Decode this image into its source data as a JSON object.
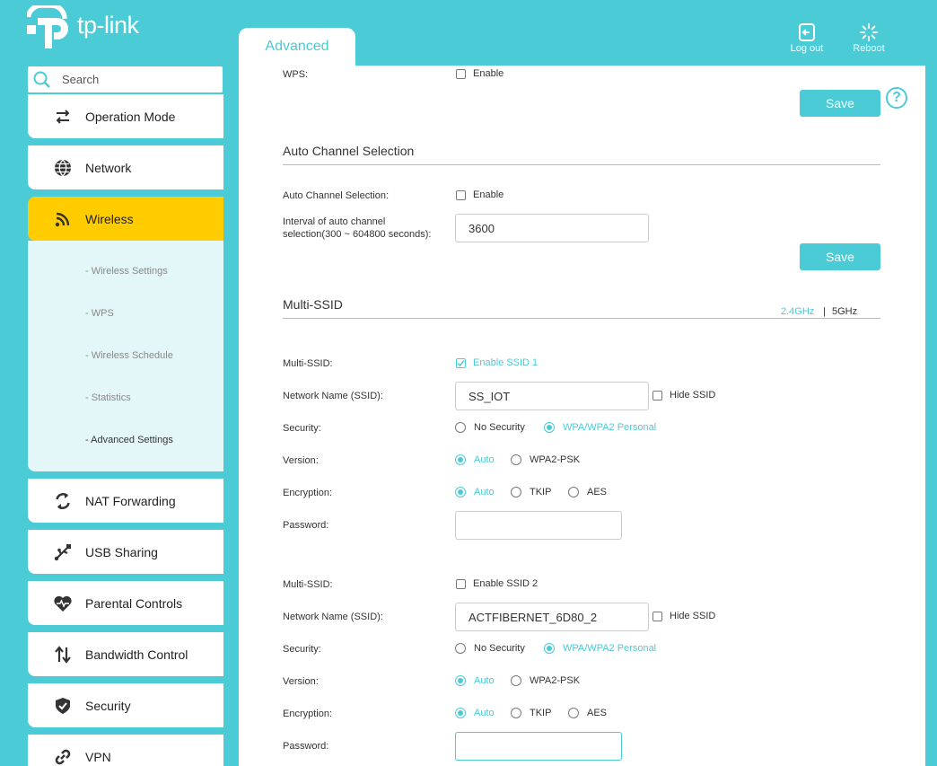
{
  "header": {
    "logo_text": "tp-link",
    "tab_label": "Advanced",
    "logout_label": "Log out",
    "reboot_label": "Reboot"
  },
  "sidebar": {
    "search_placeholder": "Search",
    "items": [
      {
        "label": "Operation Mode",
        "icon": "operation-mode-icon"
      },
      {
        "label": "Network",
        "icon": "globe-icon"
      },
      {
        "label": "Wireless",
        "icon": "wifi-icon",
        "active": true
      },
      {
        "label": "NAT Forwarding",
        "icon": "nat-icon"
      },
      {
        "label": "USB Sharing",
        "icon": "usb-icon"
      },
      {
        "label": "Parental Controls",
        "icon": "heart-icon"
      },
      {
        "label": "Bandwidth Control",
        "icon": "bandwidth-icon"
      },
      {
        "label": "Security",
        "icon": "shield-icon"
      },
      {
        "label": "VPN",
        "icon": "link-icon"
      }
    ],
    "submenu": [
      "- Wireless Settings",
      "- WPS",
      "- Wireless Schedule",
      "- Statistics",
      "- Advanced Settings"
    ]
  },
  "main": {
    "wps_label": "WPS:",
    "wps_enable": "Enable",
    "save_label": "Save",
    "help_label": "?",
    "auto_channel": {
      "title": "Auto Channel Selection",
      "label": "Auto Channel Selection:",
      "enable": "Enable",
      "interval_label_1": "Interval of auto channel",
      "interval_label_2": "selection(300 ~ 604800 seconds):",
      "interval_value": "3600"
    },
    "multi_ssid": {
      "title": "Multi-SSID",
      "band_24": "2.4GHz",
      "band_sep": "|",
      "band_5": "5GHz",
      "ssid1": {
        "multi_label": "Multi-SSID:",
        "enable_label": "Enable SSID 1",
        "enabled": true,
        "name_label": "Network Name (SSID):",
        "name_value": "SS_IOT",
        "hide": "Hide SSID",
        "security_label": "Security:",
        "sec_none": "No Security",
        "sec_wpa": "WPA/WPA2 Personal",
        "version_label": "Version:",
        "ver_auto": "Auto",
        "ver_wpa2": "WPA2-PSK",
        "enc_label": "Encryption:",
        "enc_auto": "Auto",
        "enc_tkip": "TKIP",
        "enc_aes": "AES",
        "password_label": "Password:",
        "password_value": ""
      },
      "ssid2": {
        "multi_label": "Multi-SSID:",
        "enable_label": "Enable SSID 2",
        "enabled": false,
        "name_label": "Network Name (SSID):",
        "name_value": "ACTFIBERNET_6D80_2",
        "hide": "Hide SSID",
        "security_label": "Security:",
        "sec_none": "No Security",
        "sec_wpa": "WPA/WPA2 Personal",
        "version_label": "Version:",
        "ver_auto": "Auto",
        "ver_wpa2": "WPA2-PSK",
        "enc_label": "Encryption:",
        "enc_auto": "Auto",
        "enc_tkip": "TKIP",
        "enc_aes": "AES",
        "password_label": "Password:",
        "password_value": ""
      }
    }
  },
  "colors": {
    "accent": "#4acbd6",
    "active_nav": "#ffcc00",
    "submenu_bg": "#e4f7f8"
  }
}
